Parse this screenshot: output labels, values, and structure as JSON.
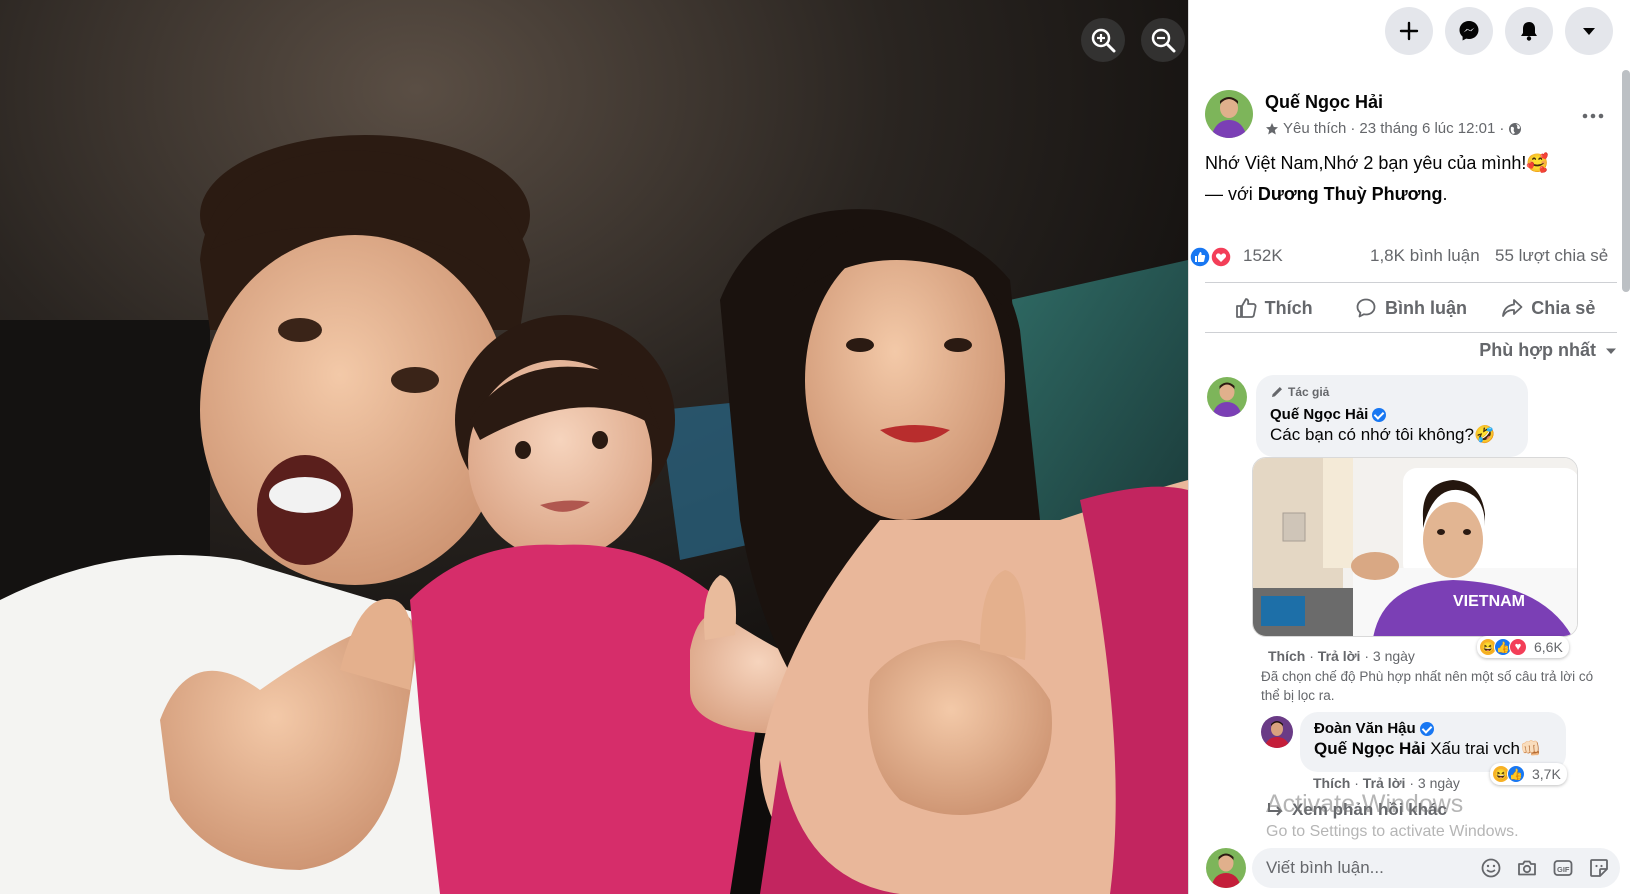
{
  "viewer": {
    "zoom_in_icon": "zoom-in-icon",
    "zoom_out_icon": "zoom-out-icon"
  },
  "topbar": {
    "buttons": [
      "plus-icon",
      "messenger-icon",
      "bell-icon",
      "caret-down-icon"
    ]
  },
  "post": {
    "author": "Quế Ngọc Hải",
    "favorite_label": "Yêu thích",
    "separator": "·",
    "date": "23 tháng 6 lúc 12:01",
    "privacy_icon": "globe-icon",
    "text": "Nhớ Việt Nam,Nhớ 2 bạn yêu của mình!🥰",
    "with_prefix": "— với",
    "with_name": "Dương Thuỳ Phương",
    "with_suffix": ".",
    "reaction_count": "152K",
    "comment_count": "1,8K bình luận",
    "share_count": "55 lượt chia sẻ",
    "actions": {
      "like": "Thích",
      "comment": "Bình luận",
      "share": "Chia sẻ"
    },
    "sort_label": "Phù hợp nhất"
  },
  "comments": {
    "first": {
      "author_badge": "Tác giả",
      "author": "Quế Ngọc Hải",
      "text": "Các bạn có nhớ tôi không?🤣",
      "like": "Thích",
      "reply": "Trả lời",
      "time": "3 ngày",
      "reaction_count": "6,6K"
    },
    "filter_note": "Đã chọn chế độ Phù hợp nhất nên một số câu trả lời có thể bị lọc ra.",
    "reply": {
      "author": "Đoàn Văn Hậu",
      "mention": "Quế Ngọc Hải",
      "text": "Xấu trai vch👊🏻",
      "like": "Thích",
      "reply": "Trả lời",
      "time": "3 ngày",
      "reaction_count": "3,7K"
    },
    "more_replies": "Xem phản hồi khác",
    "composer_placeholder": "Viết bình luận..."
  },
  "watermark": {
    "title": "Activate Windows",
    "subtitle": "Go to Settings to activate Windows."
  },
  "colors": {
    "accent": "#1877f2",
    "love": "#f33e58",
    "haha": "#f7b125",
    "secondary_text": "#65676b",
    "shirt_purple": "#7b3fb5",
    "shirt_pink": "#d62d6a"
  }
}
